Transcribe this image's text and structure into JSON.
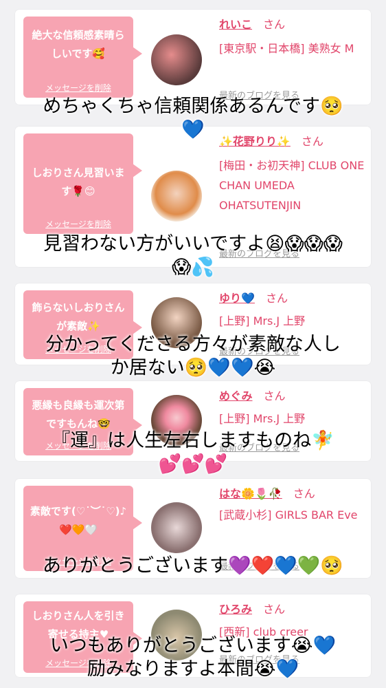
{
  "cards": [
    {
      "message": "絶大な信頼感素晴らしいです🥰",
      "delete_label": "メッセージを削除",
      "name": "れいこ",
      "san": "さん",
      "shop": "[東京駅・日本橋] 美熟女 M",
      "blog_label": "最新のブログを見る"
    },
    {
      "message": "しおりさん見習います🌹😊",
      "delete_label": "メッセージを削除",
      "name": "✨花野りり✨",
      "san": "さん",
      "shop": "[梅田・お初天神] CLUB ONE CHAN UMEDA OHATSUTENJIN",
      "blog_label": "最新のブログを見る"
    },
    {
      "message": "飾らないしおりさんが素敵✨",
      "delete_label": "メッセージを削除",
      "name": "ゆり💙",
      "san": "さん",
      "shop": "[上野] Mrs.J 上野",
      "blog_label": "最新のブログを見る"
    },
    {
      "message": "悪縁も良縁も運次第ですもんね🤓",
      "delete_label": "メッセージを削除",
      "name": "めぐみ",
      "san": "さん",
      "shop": "[上野] Mrs.J 上野",
      "blog_label": "最新のブログを見る"
    },
    {
      "message": "素敵です(♡˙︶˙♡)♪❤️🧡🤍",
      "delete_label": "メッセージを削除",
      "name": "はな🌼🌷🥀",
      "san": "さん",
      "shop": "[武蔵小杉] GIRLS BAR Eve",
      "blog_label": "最新のブログを見る"
    },
    {
      "message": "しおりさん人を引き寄せる持主♥",
      "delete_label": "メッセージを削除",
      "name": "ひろみ",
      "san": "さん",
      "shop": "[西新] club creer",
      "blog_label": "最新のブログを見る"
    }
  ],
  "captions": [
    {
      "line1": "めちゃくちゃ信頼関係あるんです🥺",
      "line2": "💙"
    },
    {
      "line1": "見習わない方がいいですよ😫😱😱😱",
      "line2": "😱💦"
    },
    {
      "line1": "分かってくださる方々が素敵な人し",
      "line2": "か居ない🥺💙💙😭"
    },
    {
      "line1": "『運』は人生左右しますものね🧚",
      "line2": "💕💕💕"
    },
    {
      "line1": "ありがとうございます💜❤️💙💚🥺",
      "line2": ""
    },
    {
      "line1": "いつもありがとうございます😭💙",
      "line2": "励みなりますよ本間😭💙"
    }
  ],
  "colors": {
    "bubble": "#f7a4b2",
    "name": "#e1456a",
    "background": "#f1f1f3"
  }
}
